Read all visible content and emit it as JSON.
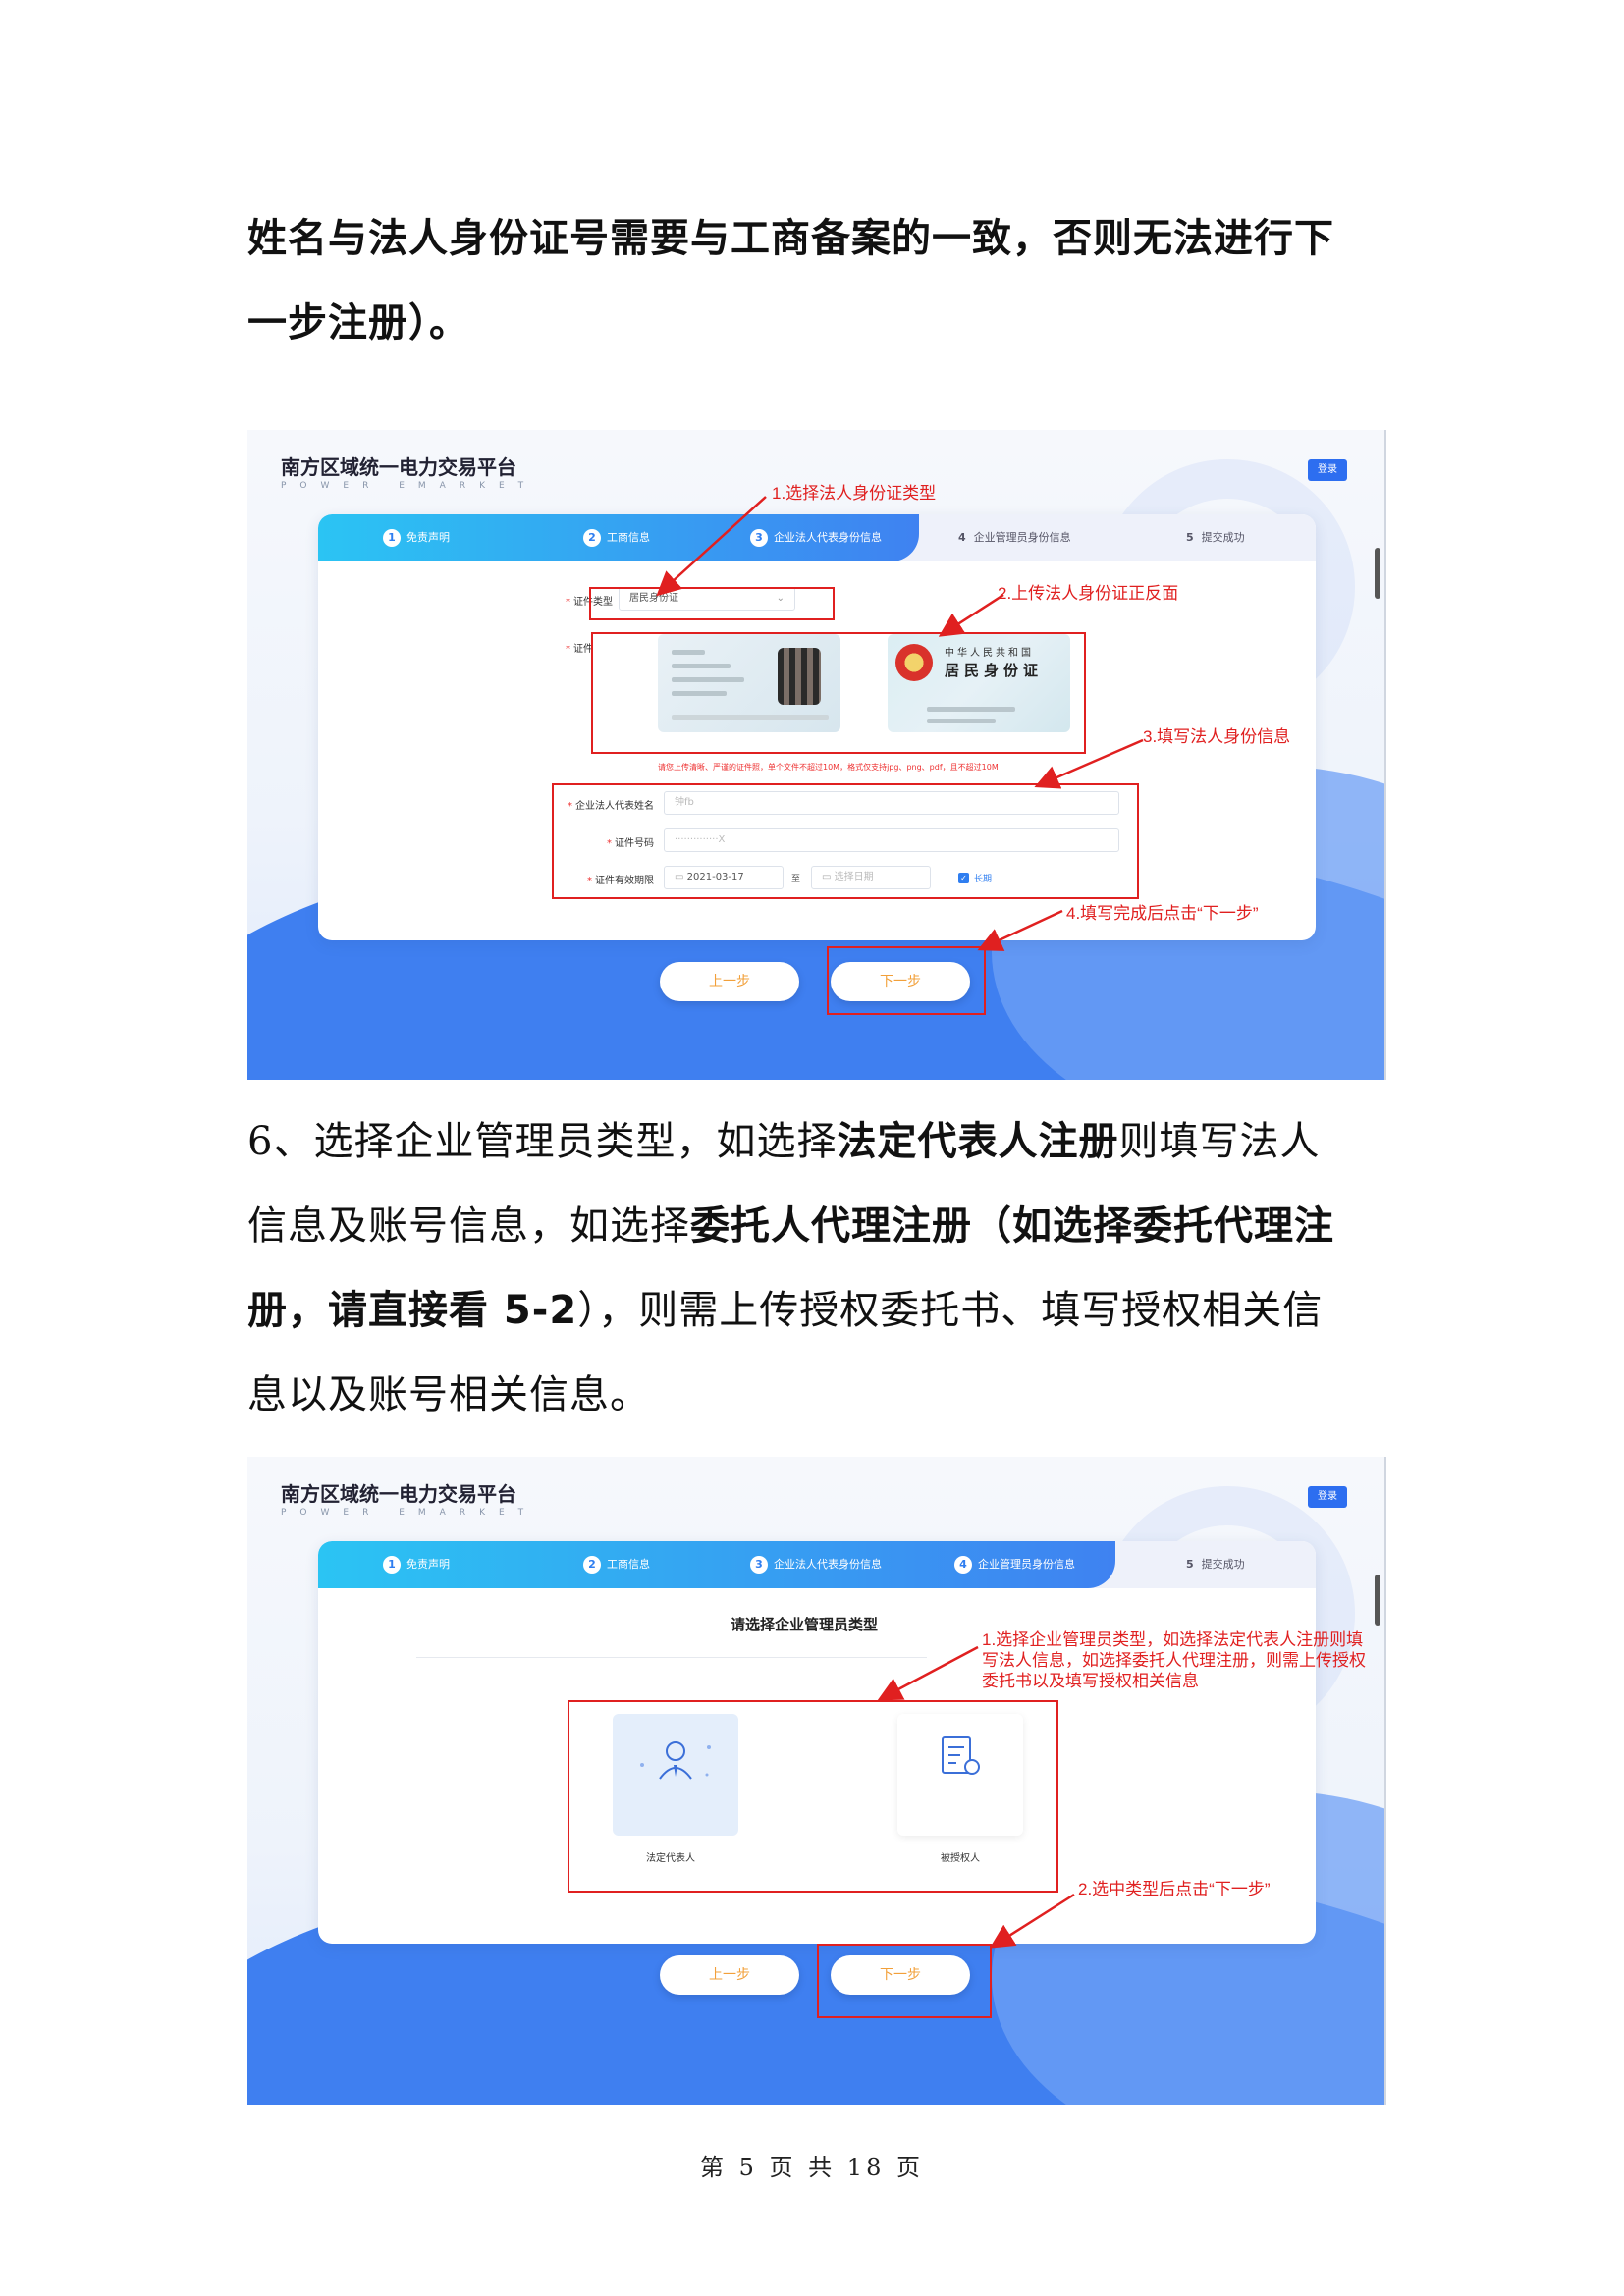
{
  "paragraph1": {
    "line1": "姓名与法人身份证号需要与工商备案的一致，否则无法进行下",
    "line2": "一步注册）。"
  },
  "paragraph2": {
    "l1_a": "6、选择企业管理员类型，如选择",
    "l1_b": "法定代表人注册",
    "l1_c": "则填写法人",
    "l2_a": "信息及账号信息，如选择",
    "l2_b": "委托人代理注册（如选择委托代理注",
    "l3_b": "册，请直接看 5-2",
    "l3_c": "），则需上传授权委托书、填写授权相关信",
    "l4": "息以及账号相关信息。"
  },
  "app": {
    "brand_name": "南方区域统一电力交易平台",
    "brand_sub": "POWER EMARKET",
    "login": "登录",
    "prev": "上一步",
    "next": "下一步"
  },
  "steps": [
    "免责声明",
    "工商信息",
    "企业法人代表身份信息",
    "企业管理员身份信息",
    "提交成功"
  ],
  "step_numbers": [
    "1",
    "2",
    "3",
    "4",
    "5"
  ],
  "screenshot1": {
    "cert_type_label": "证件类型",
    "cert_type_value": "居民身份证",
    "cert_label": "证件",
    "back_title": "中华人民共和国",
    "back_main": "居民身份证",
    "upload_hint": "请您上传清晰、严谨的证件照，单个文件不超过10M，格式仅支持jpg、png、pdf，且不超过10M",
    "rep_name_label": "企业法人代表姓名",
    "rep_name_value": "钟fb",
    "id_no_label": "证件号码",
    "id_no_value": "··············X",
    "validity_label": "证件有效期限",
    "validity_start": "2021-03-17",
    "validity_to": "至",
    "validity_end_placeholder": "选择日期",
    "long_term": "长期",
    "annotations": [
      "1.选择法人身份证类型",
      "2.上传法人身份证正反面",
      "3.填写法人身份信息",
      "4.填写完成后点击“下一步”"
    ]
  },
  "screenshot2": {
    "title": "请选择企业管理员类型",
    "option_legal": "法定代表人",
    "option_authorized": "被授权人",
    "annotation1": "1.选择企业管理员类型，如选择法定代表人注册则填写法人信息，如选择委托人代理注册，则需上传授权委托书以及填写授权相关信息",
    "annotation2": "2.选中类型后点击“下一步”"
  },
  "footer": "第 5 页 共 18 页",
  "colors": {
    "accent": "#2f7ef0",
    "annotation_red": "#e02020",
    "button_text": "#f2a03a"
  }
}
